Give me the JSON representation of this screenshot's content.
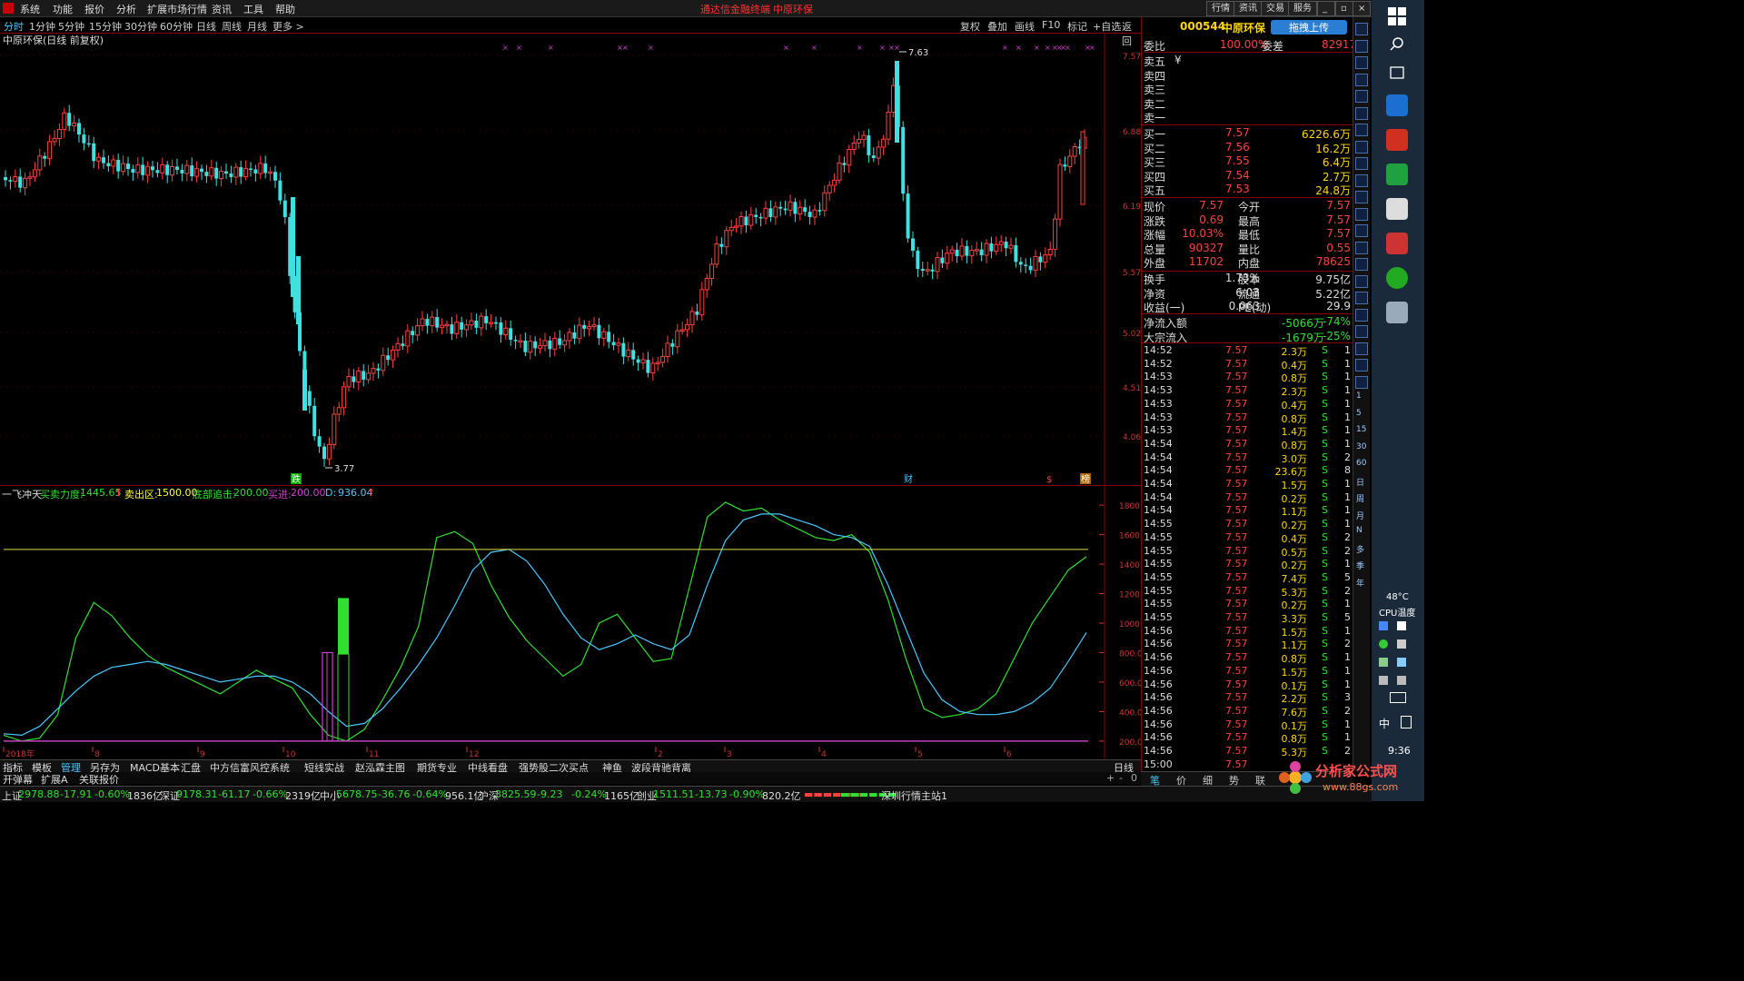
{
  "menu": {
    "items": [
      "系统",
      "功能",
      "报价",
      "分析",
      "扩展市场行情",
      "资讯",
      "工具",
      "帮助"
    ],
    "center_left": "通达信金融终端",
    "center_right": "中原环保",
    "right_buttons": [
      "行情",
      "资讯",
      "交易",
      "服务"
    ]
  },
  "periods": [
    "分时",
    "1分钟",
    "5分钟",
    "15分钟",
    "30分钟",
    "60分钟",
    "日线",
    "周线",
    "月线",
    "更多 >"
  ],
  "toolbar_right": [
    "复权",
    "叠加",
    "画线",
    "F10",
    "标记",
    "+自选",
    "返回"
  ],
  "main_chart": {
    "title": "中原环保(日线 前复权)",
    "y_ticks": [
      "7.57",
      "6.88",
      "6.19",
      "5.57",
      "5.02",
      "4.51",
      "4.06"
    ],
    "high_label": "7.63",
    "low_label": "3.77",
    "markers": [
      "跌",
      "财",
      "$",
      "榜"
    ]
  },
  "sub_chart": {
    "indicator_name": "一飞冲天",
    "params": [
      {
        "label": "买卖力度:",
        "value": "1445.65",
        "arrow": "↑",
        "color": "#30e030"
      },
      {
        "label": "卖出区:",
        "value": "1500.00",
        "color": "#ffff40"
      },
      {
        "label": "底部追击:",
        "value": "200.00",
        "color": "#30e030"
      },
      {
        "label": "买进:",
        "value": "200.00",
        "color": "#d040d0"
      },
      {
        "label": "D:",
        "value": "936.04",
        "arrow": "↑",
        "color": "#48c8ff"
      }
    ],
    "y_ticks": [
      "1800",
      "1600",
      "1400",
      "1200",
      "1000",
      "800.0",
      "600.0",
      "400.0",
      "200.0"
    ],
    "x_labels": [
      "2018年",
      "8",
      "9",
      "10",
      "11",
      "12",
      "2",
      "3",
      "4",
      "5",
      "6"
    ],
    "period_label": "日线"
  },
  "chart_data": {
    "type": "line",
    "title": "一飞冲天",
    "ylim": [
      150,
      1850
    ],
    "sell_zone": 1500,
    "bottom_chase": 200,
    "series": [
      {
        "name": "买卖力度",
        "color": "#30e030",
        "values": [
          240,
          200,
          220,
          380,
          900,
          1140,
          1050,
          900,
          780,
          700,
          640,
          580,
          520,
          600,
          680,
          620,
          560,
          380,
          240,
          200,
          280,
          480,
          700,
          980,
          1580,
          1620,
          1540,
          1260,
          1040,
          880,
          760,
          640,
          720,
          1000,
          1060,
          900,
          740,
          760,
          1240,
          1720,
          1820,
          1760,
          1780,
          1700,
          1640,
          1580,
          1560,
          1600,
          1480,
          1160,
          760,
          420,
          360,
          380,
          420,
          520,
          760,
          1000,
          1180,
          1360,
          1450
        ]
      },
      {
        "name": "D",
        "color": "#48c8ff",
        "values": [
          250,
          240,
          300,
          420,
          540,
          640,
          700,
          720,
          740,
          720,
          680,
          640,
          600,
          620,
          640,
          640,
          600,
          520,
          400,
          300,
          320,
          420,
          560,
          720,
          900,
          1120,
          1360,
          1480,
          1500,
          1420,
          1260,
          1060,
          900,
          820,
          860,
          920,
          860,
          820,
          920,
          1260,
          1560,
          1700,
          1740,
          1740,
          1700,
          1660,
          1600,
          1580,
          1520,
          1260,
          960,
          660,
          480,
          400,
          380,
          380,
          400,
          460,
          560,
          740,
          936
        ]
      }
    ],
    "buy_bars": [
      {
        "index": 20,
        "kind": "买进",
        "value": 800
      },
      {
        "index": 21,
        "kind": "买卖力度",
        "value": 1170
      }
    ]
  },
  "quote": {
    "code": "000544",
    "name": "中原环保",
    "upload_label": "拖拽上传",
    "weibi_label": "委比",
    "weibi_value": "100.00%",
    "weicha_label": "委差",
    "weicha_value": "82917",
    "sells": [
      {
        "label": "卖五",
        "price": "¥",
        "vol": ""
      },
      {
        "label": "卖四",
        "price": "",
        "vol": ""
      },
      {
        "label": "卖三",
        "price": "",
        "vol": ""
      },
      {
        "label": "卖二",
        "price": "",
        "vol": ""
      },
      {
        "label": "卖一",
        "price": "",
        "vol": ""
      }
    ],
    "buys": [
      {
        "label": "买一",
        "price": "7.57",
        "vol": "6226.6万"
      },
      {
        "label": "买二",
        "price": "7.56",
        "vol": "16.2万"
      },
      {
        "label": "买三",
        "price": "7.55",
        "vol": "6.4万"
      },
      {
        "label": "买四",
        "price": "7.54",
        "vol": "2.7万"
      },
      {
        "label": "买五",
        "price": "7.53",
        "vol": "24.8万"
      }
    ],
    "stats": [
      {
        "l1": "现价",
        "v1": "7.57",
        "l2": "今开",
        "v2": "7.57"
      },
      {
        "l1": "涨跌",
        "v1": "0.69",
        "l2": "最高",
        "v2": "7.57"
      },
      {
        "l1": "涨幅",
        "v1": "10.03%",
        "l2": "最低",
        "v2": "7.57"
      },
      {
        "l1": "总量",
        "v1": "90327",
        "l2": "量比",
        "v2": "0.55"
      },
      {
        "l1": "外盘",
        "v1": "11702",
        "l2": "内盘",
        "v2": "78625"
      }
    ],
    "stats2": [
      {
        "l1": "换手",
        "v1": "1.73%",
        "l2": "股本",
        "v2": "9.75亿"
      },
      {
        "l1": "净资",
        "v1": "6.03",
        "l2": "流通",
        "v2": "5.22亿"
      },
      {
        "l1": "收益(一)",
        "v1": "0.063",
        "l2": "PE(动)",
        "v2": "29.9"
      }
    ],
    "flows": [
      {
        "label": "净流入额",
        "v1": "-5066万",
        "v2": "-74%"
      },
      {
        "label": "大宗流入",
        "v1": "-1679万",
        "v2": "-25%"
      }
    ]
  },
  "ticks": [
    [
      "14:52",
      "7.57",
      "2.3万",
      "S",
      "1"
    ],
    [
      "14:52",
      "7.57",
      "0.4万",
      "S",
      "1"
    ],
    [
      "14:53",
      "7.57",
      "0.8万",
      "S",
      "1"
    ],
    [
      "14:53",
      "7.57",
      "2.3万",
      "S",
      "1"
    ],
    [
      "14:53",
      "7.57",
      "0.4万",
      "S",
      "1"
    ],
    [
      "14:53",
      "7.57",
      "0.8万",
      "S",
      "1"
    ],
    [
      "14:53",
      "7.57",
      "1.4万",
      "S",
      "1"
    ],
    [
      "14:54",
      "7.57",
      "0.8万",
      "S",
      "1"
    ],
    [
      "14:54",
      "7.57",
      "3.0万",
      "S",
      "2"
    ],
    [
      "14:54",
      "7.57",
      "23.6万",
      "S",
      "8"
    ],
    [
      "14:54",
      "7.57",
      "1.5万",
      "S",
      "1"
    ],
    [
      "14:54",
      "7.57",
      "0.2万",
      "S",
      "1"
    ],
    [
      "14:54",
      "7.57",
      "1.1万",
      "S",
      "1"
    ],
    [
      "14:55",
      "7.57",
      "0.2万",
      "S",
      "1"
    ],
    [
      "14:55",
      "7.57",
      "0.4万",
      "S",
      "2"
    ],
    [
      "14:55",
      "7.57",
      "0.5万",
      "S",
      "2"
    ],
    [
      "14:55",
      "7.57",
      "0.2万",
      "S",
      "1"
    ],
    [
      "14:55",
      "7.57",
      "7.4万",
      "S",
      "5"
    ],
    [
      "14:55",
      "7.57",
      "5.3万",
      "S",
      "2"
    ],
    [
      "14:55",
      "7.57",
      "0.2万",
      "S",
      "1"
    ],
    [
      "14:55",
      "7.57",
      "3.3万",
      "S",
      "5"
    ],
    [
      "14:56",
      "7.57",
      "1.5万",
      "S",
      "1"
    ],
    [
      "14:56",
      "7.57",
      "1.1万",
      "S",
      "2"
    ],
    [
      "14:56",
      "7.57",
      "0.8万",
      "S",
      "1"
    ],
    [
      "14:56",
      "7.57",
      "1.5万",
      "S",
      "1"
    ],
    [
      "14:56",
      "7.57",
      "0.1万",
      "S",
      "1"
    ],
    [
      "14:56",
      "7.57",
      "2.2万",
      "S",
      "3"
    ],
    [
      "14:56",
      "7.57",
      "7.6万",
      "S",
      "2"
    ],
    [
      "14:56",
      "7.57",
      "0.1万",
      "S",
      "1"
    ],
    [
      "14:56",
      "7.57",
      "0.8万",
      "S",
      "1"
    ],
    [
      "14:56",
      "7.57",
      "5.3万",
      "S",
      "2"
    ],
    [
      "15:00",
      "7.57",
      "",
      "",
      " "
    ]
  ],
  "icon_strip": [
    "1",
    "5",
    "15",
    "30",
    "60",
    "日",
    "周",
    "月",
    "N",
    "多",
    "季",
    "年"
  ],
  "tabs_row1": [
    "指标",
    "模板",
    "管理",
    "另存为",
    "MACD基本",
    "汇盘",
    "中方信富风控系统",
    "短线实战",
    "赵泓霖主图",
    "期货专业",
    "中线看盘",
    "强势股二次买点",
    "神鱼",
    "波段背驰背离"
  ],
  "tabs_row1_right": "日线",
  "tabs_row2": [
    "开弹幕",
    "扩展A",
    "关联报价"
  ],
  "right_tabs": [
    "笔",
    "价",
    "细",
    "势",
    "联"
  ],
  "status": {
    "items": [
      {
        "name": "上证",
        "price": "2978.88",
        "chg": "-17.91",
        "pct": "-0.60%",
        "amt": "1836亿"
      },
      {
        "name": "深证",
        "price": "9178.31",
        "chg": "-61.17",
        "pct": "-0.66%",
        "amt": "2319亿"
      },
      {
        "name": "中小",
        "price": "5678.75",
        "chg": "-36.76",
        "pct": "-0.64%",
        "amt": "956.1亿"
      },
      {
        "name": "沪深",
        "price": "3825.59",
        "chg": "-9.23",
        "pct": "-0.24%",
        "amt": "1165亿"
      },
      {
        "name": "创业",
        "price": "1511.51",
        "chg": "-13.73",
        "pct": "-0.90%",
        "amt": "820.2亿"
      }
    ],
    "station": "深圳行情主站1"
  },
  "taskbar": {
    "temp": "48°C",
    "cpu": "CPU温度",
    "ime": "中",
    "time": "9:36"
  },
  "watermark": {
    "title": "分析家公式网",
    "url": "www.88gs.com"
  }
}
